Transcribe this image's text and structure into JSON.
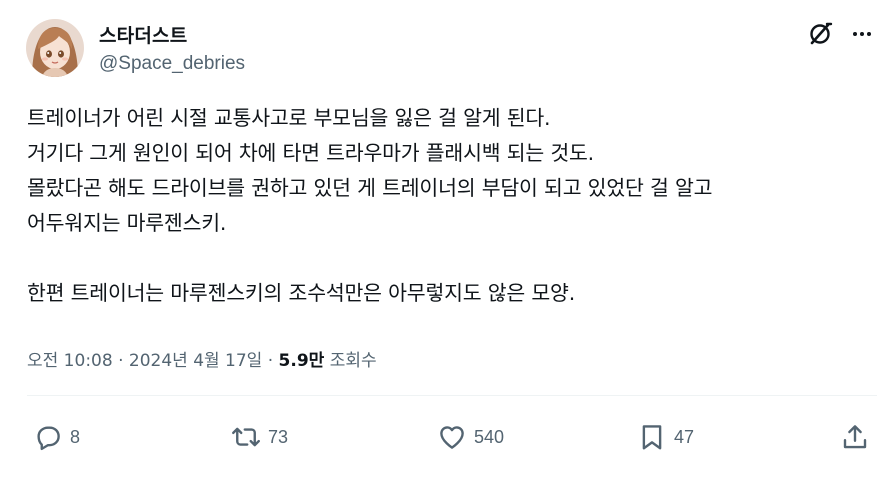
{
  "author": {
    "display_name": "스타더스트",
    "handle": "@Space_debries",
    "avatar_icon": "avatar-anime-girl"
  },
  "header_icons": [
    "grok-icon",
    "more-icon"
  ],
  "tweet": {
    "lines": [
      "트레이너가 어린 시절 교통사고로 부모님을 잃은 걸 알게 된다.",
      "거기다 그게 원인이 되어 차에 타면 트라우마가 플래시백 되는 것도.",
      "몰랐다곤 해도 드라이브를 권하고 있던 게 트레이너의 부담이 되고 있었단 걸 알고",
      "어두워지는 마루젠스키.",
      "",
      "한편 트레이너는 마루젠스키의 조수석만은 아무렇지도 않은 모양."
    ]
  },
  "meta": {
    "timestamp": "오전 10:08 · 2024년 4월 17일 · ",
    "views_count": "5.9만",
    "views_label": " 조회수"
  },
  "actions": {
    "reply_count": "8",
    "retweet_count": "73",
    "like_count": "540",
    "bookmark_count": "47"
  },
  "colors": {
    "text_primary": "#0f1419",
    "text_secondary": "#536471",
    "divider": "#eff3f4"
  }
}
